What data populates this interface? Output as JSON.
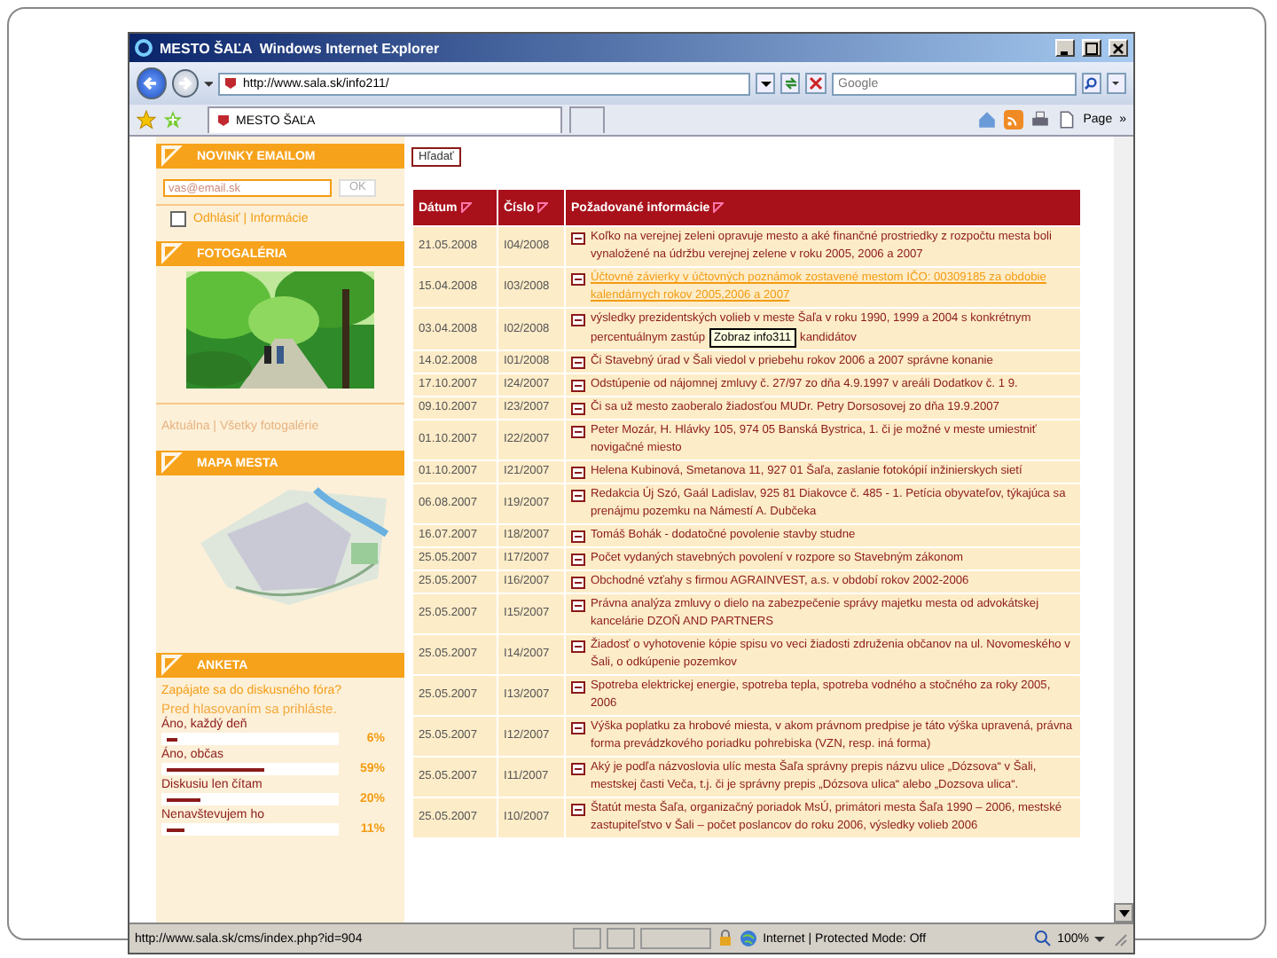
{
  "window": {
    "title": "MESTO ŠAĽA",
    "app": "Windows Internet Explorer"
  },
  "address": {
    "value": "http://www.sala.sk/info211/"
  },
  "search": {
    "placeholder": "Google"
  },
  "tab": {
    "label": "MESTO ŠAĽA"
  },
  "command_bar": {
    "page": "Page",
    "more": "»"
  },
  "sidebar": {
    "newsletter": {
      "title": "NOVINKY EMAILOM",
      "email": "vas@email.sk",
      "button": "OK",
      "unsubscribe": {
        "label": "Odhlásiť | Informácie",
        "checked": false
      }
    },
    "gallery": {
      "title": "FOTOGALÉRIA",
      "links": "Aktuálna | Všetky fotogalérie"
    },
    "map": {
      "title": "MAPA MESTA"
    },
    "poll": {
      "title": "ANKETA",
      "question": "Zapájate sa do diskusného fóra?",
      "note": "Pred hlasovaním sa prihláste.",
      "options": [
        {
          "label": "Áno, každý deň",
          "level": 0.06,
          "percent": "6%"
        },
        {
          "label": "Áno, občas",
          "level": 0.59,
          "percent": "59%"
        },
        {
          "label": "Diskusiu len čítam",
          "level": 0.2,
          "percent": "20%"
        },
        {
          "label": "Nenavštevujem ho",
          "level": 0.11,
          "percent": "11%"
        }
      ]
    }
  },
  "search_button": "Hľadať",
  "table": {
    "columns": [
      "Dátum",
      "Číslo",
      "Požadované informácie"
    ],
    "rows": [
      {
        "date": "21.05.2008",
        "number": "I04/2008",
        "text": "Koľko na verejnej zeleni opravuje mesto a aké finančné prostriedky z rozpočtu mesta boli vynaložené na údržbu verejnej zelene v roku 2005, 2006 a 2007",
        "hovered": false
      },
      {
        "date": "15.04.2008",
        "number": "I03/2008",
        "text": "Účtovné závierky v účtovných poznámok zostavené mestom IČO: 00309185 za obdobie kalendárnych rokov 2005,2006 a 2007",
        "hovered": true
      },
      {
        "date": "03.04.2008",
        "number": "I02/2008",
        "text": "výsledky prezidentských volieb v meste Šaľa v roku 1990, 1999 a 2004 s konkrétnym",
        "text_cont": "percentuálnym zastúp",
        "tooltip": "Zobraz info311",
        "text_after": "kandidátov",
        "hovered": false
      },
      {
        "date": "14.02.2008",
        "number": "I01/2008",
        "text": "Či Stavebný úrad v Šali viedol v priebehu rokov 2006 a 2007 správne konanie",
        "hovered": false
      },
      {
        "date": "17.10.2007",
        "number": "I24/2007",
        "text": "Odstúpenie od nájomnej zmluvy č. 27/97 zo dňa 4.9.1997 v areáli Dodatkov č. 1 9.",
        "hovered": false
      },
      {
        "date": "09.10.2007",
        "number": "I23/2007",
        "text": "Či sa už mesto zaoberalo žiadosťou MUDr. Petry Dorsosovej zo dňa 19.9.2007",
        "hovered": false
      },
      {
        "date": "01.10.2007",
        "number": "I22/2007",
        "text": "Peter Mozár, H. Hlávky 105, 974 05 Banská Bystrica, 1. či je možné v meste umiestniť novigačné miesto",
        "hovered": false
      },
      {
        "date": "01.10.2007",
        "number": "I21/2007",
        "text": "Helena Kubinová, Smetanova 11, 927 01 Šaľa, zaslanie fotokópií inžinierskych sietí",
        "hovered": false
      },
      {
        "date": "06.08.2007",
        "number": "I19/2007",
        "text": "Redakcia Új Szó, Gaál Ladislav, 925 81 Diakovce č. 485 - 1. Petícia obyvateľov, týkajúca sa prenájmu pozemku na Námestí A. Dubčeka",
        "hovered": false
      },
      {
        "date": "16.07.2007",
        "number": "I18/2007",
        "text": "Tomáš Bohák - dodatočné povolenie stavby studne",
        "hovered": false
      },
      {
        "date": "25.05.2007",
        "number": "I17/2007",
        "text": "Počet vydaných stavebných povolení v rozpore so Stavebným zákonom",
        "hovered": false
      },
      {
        "date": "25.05.2007",
        "number": "I16/2007",
        "text": "Obchodné vzťahy s firmou AGRAINVEST, a.s. v období rokov 2002-2006",
        "hovered": false
      },
      {
        "date": "25.05.2007",
        "number": "I15/2007",
        "text": "Právna analýza zmluvy o dielo na zabezpečenie správy majetku mesta od advokátskej kancelárie DZOŇ AND PARTNERS",
        "hovered": false
      },
      {
        "date": "25.05.2007",
        "number": "I14/2007",
        "text": "Žiadosť o vyhotovenie kópie spisu vo veci žiadosti združenia občanov na ul. Novomeského v Šali, o odkúpenie pozemkov",
        "hovered": false
      },
      {
        "date": "25.05.2007",
        "number": "I13/2007",
        "text": "Spotreba elektrickej energie, spotreba tepla, spotreba vodného a stočného za roky 2005, 2006",
        "hovered": false
      },
      {
        "date": "25.05.2007",
        "number": "I12/2007",
        "text": "Výška poplatku za hrobové miesta, v akom právnom predpise je táto výška upravená, právna forma prevádzkového poriadku pohrebiska (VZN, resp. iná forma)",
        "hovered": false
      },
      {
        "date": "25.05.2007",
        "number": "I11/2007",
        "text": "Aký je podľa názvoslovia ulíc mesta Šaľa správny prepis názvu ulice „Dózsova“ v Šali, mestskej časti Veča, t.j. či je správny prepis „Dózsova ulica“ alebo „Dozsova ulica“.",
        "hovered": false
      },
      {
        "date": "25.05.2007",
        "number": "I10/2007",
        "text": "Štatút mesta Šaľa, organizačný poriadok MsÚ, primátori mesta Šaľa 1990 – 2006, mestské zastupiteľstvo v Šali – počet poslancov do roku 2006, výsledky volieb 2006",
        "hovered": false
      }
    ]
  },
  "status_bar": {
    "url": "http://www.sala.sk/cms/index.php?id=904",
    "zone": "Internet | Protected Mode: Off",
    "zoom": "100%"
  }
}
